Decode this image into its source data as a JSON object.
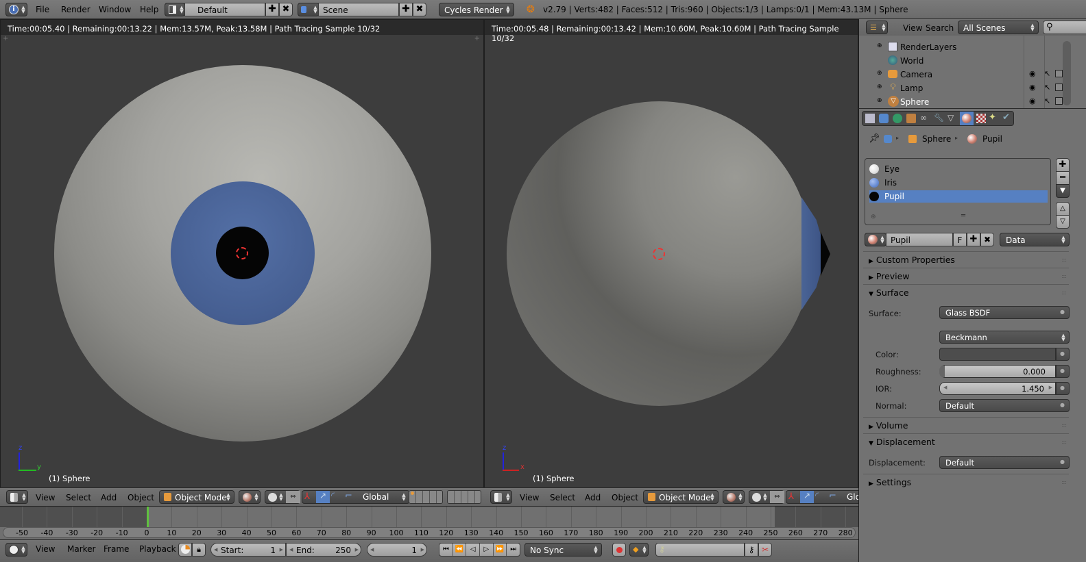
{
  "topbar": {
    "menus": [
      "File",
      "Render",
      "Window",
      "Help"
    ],
    "layout": "Default",
    "scene": "Scene",
    "engine": "Cycles Render",
    "stats": "v2.79 | Verts:482 | Faces:512 | Tris:960 | Objects:1/3 | Lamps:0/1 | Mem:43.13M | Sphere"
  },
  "viewport_left": {
    "render_info": "Time:00:05.40 | Remaining:00:13.22 | Mem:13.57M, Peak:13.58M | Path Tracing Sample 10/32",
    "object_label": "(1) Sphere",
    "axis_labels": {
      "vertical": "z",
      "horizontal": "y"
    },
    "menus": [
      "View",
      "Select",
      "Add",
      "Object"
    ],
    "mode": "Object Mode",
    "orientation": "Global"
  },
  "viewport_right": {
    "render_info": "Time:00:05.48 | Remaining:00:13.42 | Mem:10.60M, Peak:10.60M | Path Tracing Sample 10/32",
    "object_label": "(1) Sphere",
    "axis_labels": {
      "vertical": "z",
      "horizontal": "x"
    },
    "menus": [
      "View",
      "Select",
      "Add",
      "Object"
    ],
    "mode": "Object Mode",
    "orientation": "Glo"
  },
  "outliner": {
    "menus": [
      "View",
      "Search"
    ],
    "filter": "All Scenes",
    "items": [
      {
        "label": "RenderLayers"
      },
      {
        "label": "World"
      },
      {
        "label": "Camera"
      },
      {
        "label": "Lamp"
      },
      {
        "label": "Sphere"
      }
    ]
  },
  "properties": {
    "breadcrumb": [
      "Sphere",
      "Pupil"
    ],
    "material_slots": [
      {
        "name": "Eye",
        "color": "#e8e8e8"
      },
      {
        "name": "Iris",
        "color": "#6b8fd6"
      },
      {
        "name": "Pupil",
        "color": "#050505"
      }
    ],
    "active_slot": "Pupil",
    "material_name": "Pupil",
    "fake_user": "F",
    "link": "Data",
    "panels": {
      "custom_properties": "Custom Properties",
      "preview": "Preview",
      "surface": "Surface",
      "volume": "Volume",
      "displacement": "Displacement",
      "settings": "Settings"
    },
    "surface": {
      "surface_label": "Surface:",
      "surface_value": "Glass BSDF",
      "distribution": "Beckmann",
      "color_label": "Color:",
      "roughness_label": "Roughness:",
      "roughness_value": "0.000",
      "ior_label": "IOR:",
      "ior_value": "1.450",
      "normal_label": "Normal:",
      "normal_value": "Default"
    },
    "displacement": {
      "label": "Displacement:",
      "value": "Default"
    }
  },
  "timeline": {
    "ticks": [
      -50,
      -40,
      -30,
      -20,
      -10,
      0,
      10,
      20,
      30,
      40,
      50,
      60,
      70,
      80,
      90,
      100,
      110,
      120,
      130,
      140,
      150,
      160,
      170,
      180,
      190,
      200,
      210,
      220,
      230,
      240,
      250,
      260,
      270,
      280
    ],
    "current_frame": 1,
    "menus": [
      "View",
      "Marker",
      "Frame",
      "Playback"
    ],
    "start_label": "Start:",
    "start": "1",
    "end_label": "End:",
    "end": "250",
    "frame": "1",
    "sync": "No Sync"
  },
  "colors": {
    "accent_blue": "#5680c2",
    "frame_cursor": "#60c040",
    "iris_blue": "#4a6496"
  }
}
